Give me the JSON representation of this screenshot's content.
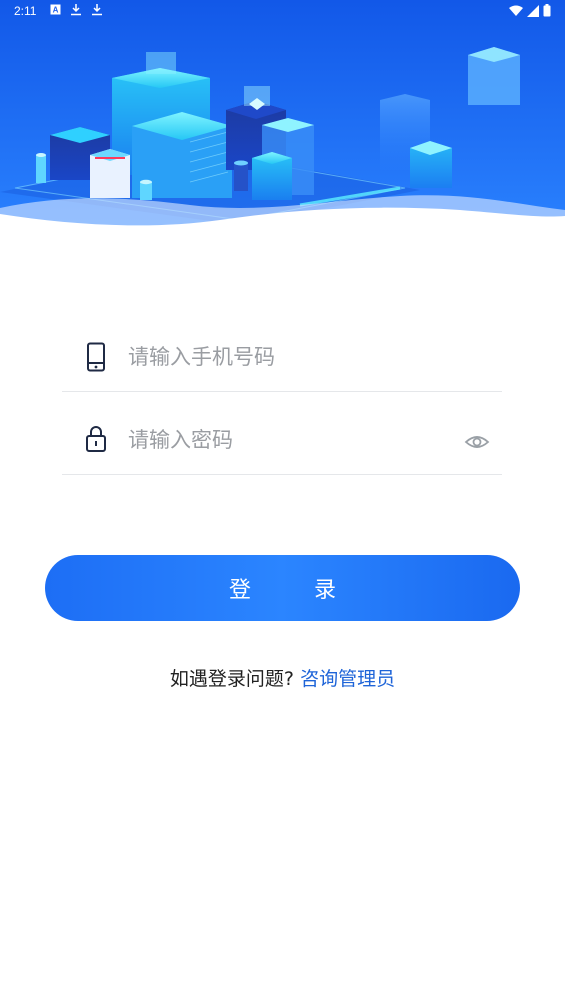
{
  "status_bar": {
    "time": "2:11",
    "left_icons": [
      "a-box-icon",
      "download-icon",
      "download-icon"
    ],
    "right_icons": [
      "wifi-icon",
      "signal-icon",
      "battery-icon"
    ]
  },
  "hero": {
    "icon": "city-isometric-illustration",
    "colors": {
      "top": "#1258e8",
      "bottom": "#2680ff",
      "wave": "#ffffff"
    }
  },
  "form": {
    "phone": {
      "placeholder": "请输入手机号码",
      "value": "",
      "icon": "phone-icon"
    },
    "password": {
      "placeholder": "请输入密码",
      "value": "",
      "icon": "lock-icon",
      "toggle_icon": "eye-icon"
    }
  },
  "login_button": {
    "label": "登 录"
  },
  "help": {
    "text": "如遇登录问题?",
    "link": "咨询管理员"
  },
  "colors": {
    "primary": "#1e6ef5",
    "link": "#1e64d8",
    "divider": "#e5e7ea",
    "placeholder": "#9a9da2"
  }
}
